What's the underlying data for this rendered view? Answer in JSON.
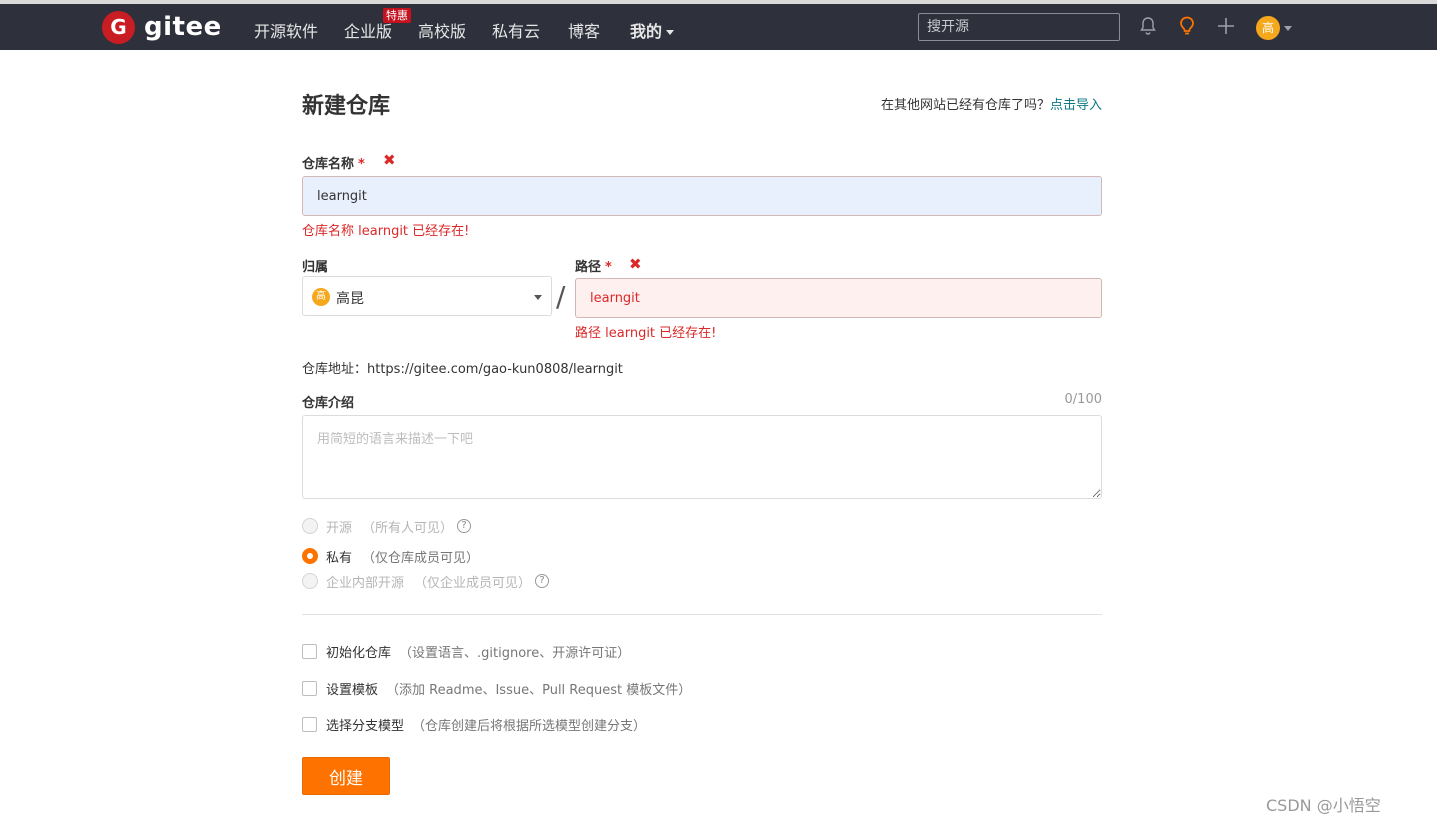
{
  "navbar": {
    "logo_letter": "G",
    "logo_text": "gitee",
    "items": [
      "开源软件",
      "企业版",
      "高校版",
      "私有云",
      "博客",
      "我的"
    ],
    "enterprise_badge": "特惠",
    "search_placeholder": "搜开源",
    "avatar_text": "高",
    "icons": [
      "bell-icon",
      "lightbulb-icon",
      "plus-icon"
    ]
  },
  "page": {
    "title": "新建仓库",
    "import_hint": "在其他网站已经有仓库了吗？",
    "import_link": "点击导入"
  },
  "form": {
    "repo_name_label": "仓库名称",
    "required_mark": "*",
    "error_mark": "✖",
    "repo_name_value": "learngit",
    "repo_name_error": "仓库名称 learngit 已经存在!",
    "owner_label": "归属",
    "owner_avatar": "高",
    "owner_value": "高昆",
    "slash": "/",
    "path_label": "路径",
    "path_value": "learngit",
    "path_error": "路径 learngit 已经存在!",
    "repo_address": "仓库地址：https://gitee.com/gao-kun0808/learngit",
    "intro_label": "仓库介绍",
    "intro_counter": "0/100",
    "intro_placeholder": "用简短的语言来描述一下吧",
    "visibility": [
      {
        "label": "开源",
        "hint": "（所有人可见）",
        "selected": false,
        "disabled": true,
        "help": true
      },
      {
        "label": "私有",
        "hint": "（仅仓库成员可见）",
        "selected": true,
        "disabled": false,
        "help": false
      },
      {
        "label": "企业内部开源",
        "hint": "（仅企业成员可见）",
        "selected": false,
        "disabled": true,
        "help": true
      }
    ],
    "help_glyph": "?",
    "options": [
      {
        "label": "初始化仓库",
        "hint": "（设置语言、.gitignore、开源许可证）",
        "checked": false
      },
      {
        "label": "设置模板",
        "hint": "（添加 Readme、Issue、Pull Request 模板文件）",
        "checked": false
      },
      {
        "label": "选择分支模型",
        "hint": "（仓库创建后将根据所选模型创建分支）",
        "checked": false
      }
    ],
    "create_button": "创建"
  },
  "watermark": "CSDN @小悟空",
  "colors": {
    "navbar_bg": "#2e313c",
    "accent": "#fe7300",
    "error": "#db2828",
    "link": "#0c7986"
  }
}
